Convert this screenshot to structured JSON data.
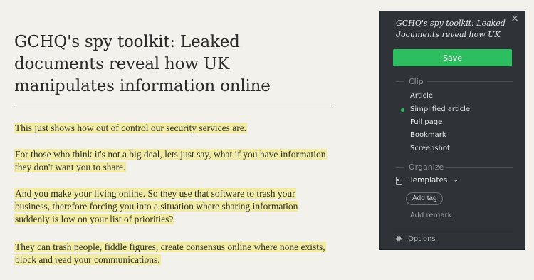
{
  "article": {
    "title": "GCHQ's spy toolkit: Leaked documents reveal how UK manipulates information online",
    "paragraphs": [
      "This just shows how out of control our security services are.",
      "For those who think it's not a big deal, lets just say, what if you have information they don't want you to share.",
      "And you make your living online. So they use that software to trash your business, therefore forcing you into a situation where sharing information suddenly is low on your list of priorities?",
      "They can trash people, fiddle figures, create consensus online where none exists, block and read your communications."
    ],
    "highlight_color": "#f1eba3"
  },
  "clipper": {
    "close_icon": "×",
    "title": "GCHQ's spy toolkit: Leaked documents reveal how UK",
    "save_label": "Save",
    "clip_heading": "Clip",
    "clip_options": [
      "Article",
      "Simplified article",
      "Full page",
      "Bookmark",
      "Screenshot"
    ],
    "selected_option": "Simplified article",
    "organize_heading": "Organize",
    "templates_label": "Templates",
    "templates_chevron": "⌄",
    "add_tag_label": "Add tag",
    "add_remark_placeholder": "Add remark",
    "options_label": "Options",
    "accent_color": "#2dbe60",
    "panel_color": "#2f3338"
  }
}
